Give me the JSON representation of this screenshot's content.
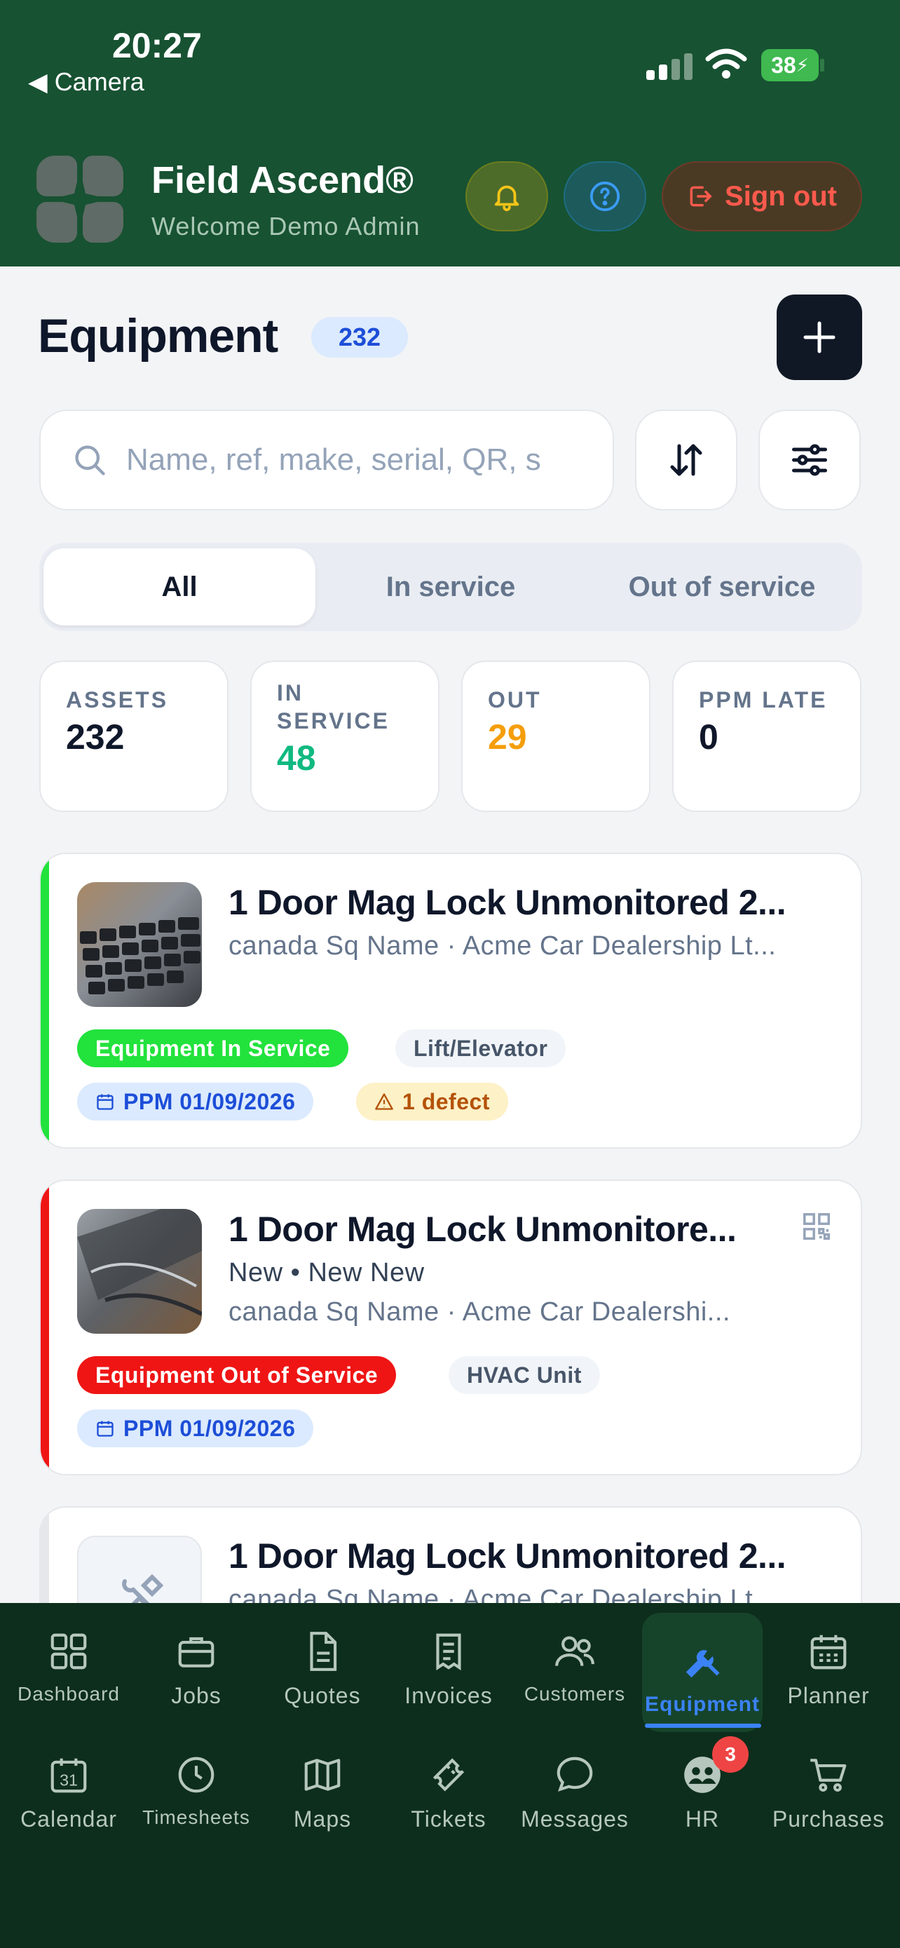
{
  "status_bar": {
    "time": "20:27",
    "back_label": "◀ Camera",
    "battery": "38"
  },
  "header": {
    "app_name": "Field Ascend®",
    "welcome": "Welcome Demo Admin",
    "sign_out": "Sign out"
  },
  "page": {
    "title": "Equipment",
    "count": "232",
    "search_placeholder": "Name, ref, make, serial, QR, s"
  },
  "tabs": [
    {
      "label": "All",
      "active": true
    },
    {
      "label": "In service",
      "active": false
    },
    {
      "label": "Out of service",
      "active": false
    }
  ],
  "stats": [
    {
      "label": "ASSETS",
      "value": "232",
      "color": "#0f172a"
    },
    {
      "label": "IN SERVICE",
      "value": "48",
      "color": "#10b981"
    },
    {
      "label": "OUT",
      "value": "29",
      "color": "#f59e0b"
    },
    {
      "label": "PPM LATE",
      "value": "0",
      "color": "#0f172a"
    }
  ],
  "cards": [
    {
      "title": "1 Door Mag Lock Unmonitored 2...",
      "meta": "",
      "location": "canada Sq Name · Acme Car Dealership Lt...",
      "status": "Equipment In Service",
      "status_color": "#22e23c",
      "category": "Lift/Elevator",
      "ppm": "PPM 01/09/2026",
      "defect": "1 defect",
      "stripe_color": "#22e23c"
    },
    {
      "title": "1 Door Mag Lock Unmonitore...",
      "meta": "New • New New",
      "location": "canada Sq Name · Acme Car Dealershi...",
      "status": "Equipment Out of Service",
      "status_color": "#ef1515",
      "category": "HVAC Unit",
      "ppm": "PPM 01/09/2026",
      "stripe_color": "#ef1515"
    },
    {
      "title": "1 Door Mag Lock Unmonitored 2...",
      "location": "canada Sq Name · Acme Car Dealership Lt...",
      "stripe_color": "#e5e7eb"
    }
  ],
  "nav": [
    {
      "label": "Dashboard",
      "icon": "grid-icon"
    },
    {
      "label": "Jobs",
      "icon": "briefcase-icon"
    },
    {
      "label": "Quotes",
      "icon": "document-icon"
    },
    {
      "label": "Invoices",
      "icon": "receipt-icon"
    },
    {
      "label": "Customers",
      "icon": "users-icon"
    },
    {
      "label": "Equipment",
      "icon": "tools-icon",
      "active": true
    },
    {
      "label": "Planner",
      "icon": "calendar-grid-icon"
    },
    {
      "label": "Calendar",
      "icon": "calendar-31-icon"
    },
    {
      "label": "Timesheets",
      "icon": "clock-icon"
    },
    {
      "label": "Maps",
      "icon": "map-icon"
    },
    {
      "label": "Tickets",
      "icon": "ticket-icon"
    },
    {
      "label": "Messages",
      "icon": "chat-icon"
    },
    {
      "label": "HR",
      "icon": "group-icon",
      "badge": "3"
    },
    {
      "label": "Purchases",
      "icon": "cart-icon"
    }
  ]
}
